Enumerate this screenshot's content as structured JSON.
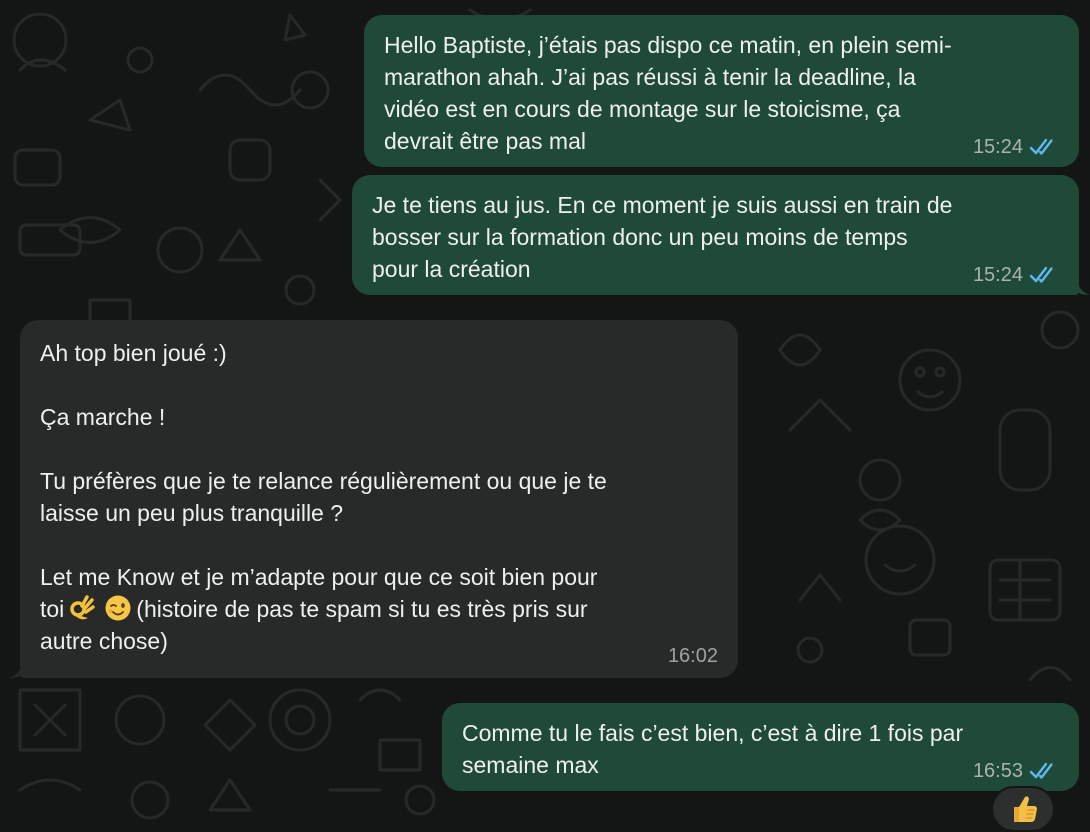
{
  "colors": {
    "background": "#141615",
    "outgoing_bubble": "#1f4a38",
    "incoming_bubble": "#272a29",
    "read_ticks": "#5fb8f0",
    "text": "#eef0ef"
  },
  "messages": [
    {
      "direction": "out",
      "text": "Hello Baptiste, j’étais pas dispo ce matin, en plein semi-\nmarathon ahah. J’ai pas réussi à tenir la deadline, la\nvidéo est en cours de montage sur le stoicisme, ça\ndevrait être pas mal",
      "time": "15:24",
      "status": "read"
    },
    {
      "direction": "out",
      "text": "Je te tiens au jus. En ce moment je suis aussi en train de\nbosser sur la formation donc un peu moins de temps\npour la création",
      "time": "15:24",
      "status": "read"
    },
    {
      "direction": "in",
      "text_main": "Ah top bien joué :)\n\nÇa marche !\n\nTu préfères que je te relance régulièrement ou que je te\nlaisse un peu plus tranquille ?\n\nLet me Know et je m’adapte pour que ce soit bien pour",
      "text_line_prefix": "toi",
      "emojis": [
        "ok-hand-emoji",
        "winking-face-emoji"
      ],
      "text_after_emojis": "(histoire de pas te spam si tu es très pris sur\nautre chose)",
      "time": "16:02"
    },
    {
      "direction": "out",
      "text": "Comme tu le fais c’est bien, c’est à dire 1 fois par\nsemaine max",
      "time": "16:53",
      "status": "read",
      "reaction": "thumbs-up-emoji"
    }
  ]
}
